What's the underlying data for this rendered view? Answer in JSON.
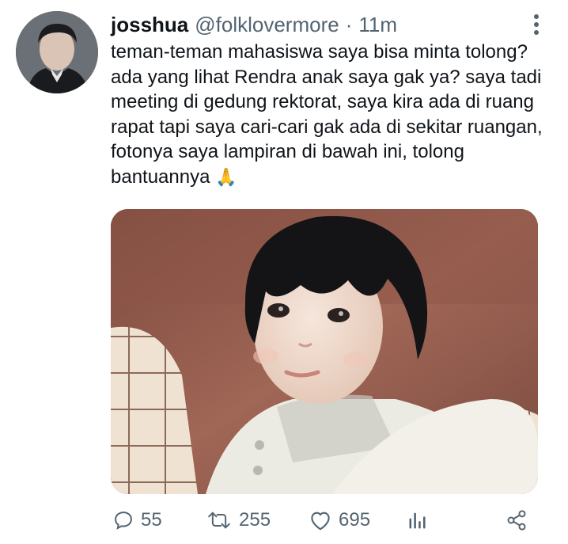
{
  "tweet": {
    "display_name": "josshua",
    "handle": "@folklovermore",
    "separator": "·",
    "time": "11m",
    "text": "teman-teman mahasiswa saya bisa minta tolong? ada yang lihat Rendra anak saya gak ya? saya tadi meeting di gedung rektorat, saya kira ada di ruang rapat tapi saya cari-cari gak ada di sekitar ruangan, fotonya saya lampiran di bawah ini, tolong bantuannya",
    "emoji": "🙏"
  },
  "metrics": {
    "replies": "55",
    "retweets": "255",
    "likes": "695"
  },
  "icons": {
    "more": "more-vertical-icon",
    "reply": "reply-icon",
    "retweet": "retweet-icon",
    "like": "heart-icon",
    "stats": "stats-icon",
    "share": "share-icon"
  },
  "colors": {
    "text": "#0f1419",
    "secondary": "#536471",
    "background": "#ffffff"
  }
}
